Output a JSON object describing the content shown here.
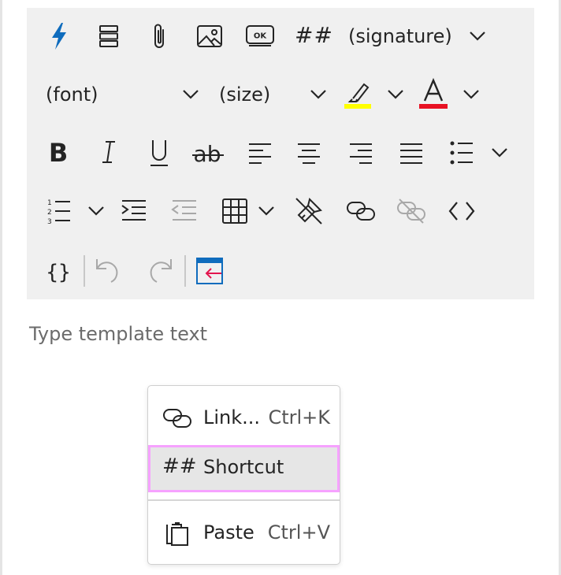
{
  "toolbar": {
    "signature_label": "(signature)",
    "font_label": "(font)",
    "size_label": "(size)",
    "shortcut_glyph": "##",
    "buttons": [
      "lightning-icon",
      "layout-icon",
      "attach-icon",
      "image-icon",
      "ok-button-icon",
      "highlight-color-icon",
      "font-color-icon",
      "bold-icon",
      "italic-icon",
      "underline-icon",
      "strikethrough-icon",
      "align-left-icon",
      "align-center-icon",
      "align-right-icon",
      "justify-icon",
      "bullet-list-icon",
      "numbered-list-icon",
      "indent-icon",
      "outdent-icon",
      "table-icon",
      "clear-format-icon",
      "link-icon",
      "unlink-icon",
      "code-view-icon",
      "braces-icon",
      "undo-icon",
      "redo-icon",
      "insert-template-icon"
    ],
    "colors": {
      "accent": "#0f6cbd",
      "highlight": "#ffff00",
      "font_color": "#e81123",
      "disabled": "#a8a8a8",
      "insert_arrow": "#e3154e"
    }
  },
  "editor": {
    "placeholder": "Type template text"
  },
  "context_menu": {
    "items": [
      {
        "label": "Link...",
        "shortcut": "Ctrl+K",
        "icon": "link-icon"
      },
      {
        "label": "Shortcut",
        "glyph": "##",
        "icon": "hash-icon",
        "highlighted": true
      },
      {
        "label": "Paste",
        "shortcut": "Ctrl+V",
        "icon": "paste-icon"
      }
    ]
  }
}
